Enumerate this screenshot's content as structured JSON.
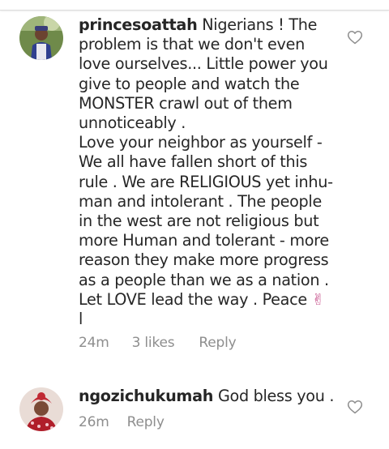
{
  "comments": [
    {
      "username": "princesoattah",
      "text": " Nigerians ! The problem is that we don't even love ourselves... Little power you give to people and watch the MONSTER crawl out of them unnoticeably .\nLove your neighbor as yourself - We all have fallen short of this rule . We are RELIGIOUS yet inhu-man and intolerant . The people in the west are not religious but more Human and tolerant - more reason they make more progress as a people than we as a nation . Let LOVE lead the way . Peace ",
      "emoji": "✌",
      "trailing": "\nl",
      "time": "24m",
      "likes": "3 likes",
      "reply": "Reply",
      "avatar": "avatar-man-blue-outfit",
      "like_icon": "heart-outline-icon"
    },
    {
      "username": "ngozichukumah",
      "text": " God bless you .",
      "time": "26m",
      "reply": "Reply",
      "avatar": "avatar-woman-red-headwrap",
      "like_icon": "heart-outline-icon"
    }
  ],
  "colors": {
    "text": "#262626",
    "meta": "#8e8e8e",
    "emoji": "#c64f8a"
  }
}
